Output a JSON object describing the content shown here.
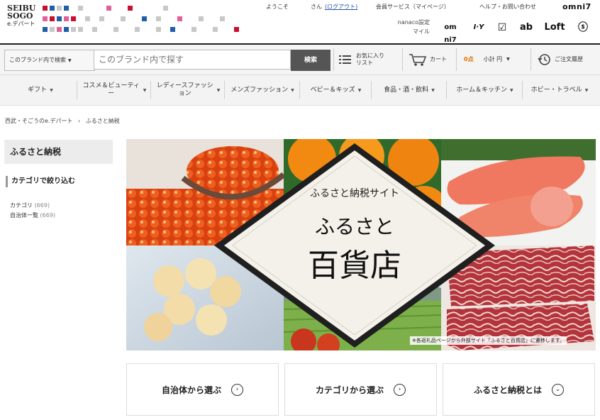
{
  "header": {
    "logo_line1": "SEIBU",
    "logo_line2": "SOGO",
    "logo_line3": "e.デパート",
    "welcome": "ようこそ",
    "san": "さん",
    "logout": "(ログアウト)",
    "member_service": "会員サービス（マイページ）",
    "help": "ヘルプ・お問い合わせ",
    "omni7": "omni7",
    "nanaco_line1": "nanaco設定",
    "nanaco_line2": "マイル",
    "brand_colors": {
      "red": "#c8102e",
      "blue": "#1f5fa8",
      "pink": "#e0609a",
      "gray": "#c8c8c8"
    },
    "group_icons": [
      "omni7-icon",
      "itoyokado-icon",
      "sogo-icon",
      "akachan-icon",
      "loft-icon",
      "seven-icon"
    ],
    "group_icon_labels": [
      "om ni7",
      "I·Y",
      "☑",
      "ab",
      "Loft",
      "ⓢ"
    ]
  },
  "search": {
    "scope_label": "このブランド内で検索",
    "placeholder": "このブランド内で探す",
    "button": "検索",
    "favorites_line1": "お気に入り",
    "favorites_line2": "リスト",
    "cart": "カート",
    "points": "0点",
    "points_sub": "小計 円",
    "order_history": "ご注文履歴"
  },
  "categories": [
    "ギフト",
    "コスメ＆ビューティー",
    "レディースファッション",
    "メンズファッション",
    "ベビー＆キッズ",
    "食品・酒・飲料",
    "ホーム＆キッチン",
    "ホビー・トラベル"
  ],
  "breadcrumb": {
    "home": "西武・そごうのe.デパート",
    "sep": "›",
    "current": "ふるさと納税"
  },
  "sidebar": {
    "title": "ふるさと納税",
    "filter_heading": "カテゴリで絞り込む",
    "links": [
      {
        "label": "カテゴリ",
        "count": "(669)"
      },
      {
        "label": "自治体一覧",
        "count": "(669)"
      }
    ]
  },
  "hero": {
    "subtitle": "ふるさと納税サイト",
    "title_line1": "ふるさと",
    "title_line2": "百貨店",
    "note": "※各返礼品ページから外部サイト「ふるさと百貨店」に遷移します。"
  },
  "actions": [
    {
      "label": "自治体から選ぶ",
      "icon": "›"
    },
    {
      "label": "カテゴリから選ぶ",
      "icon": "›"
    },
    {
      "label": "ふるさと納税とは",
      "icon": "⌄"
    }
  ]
}
